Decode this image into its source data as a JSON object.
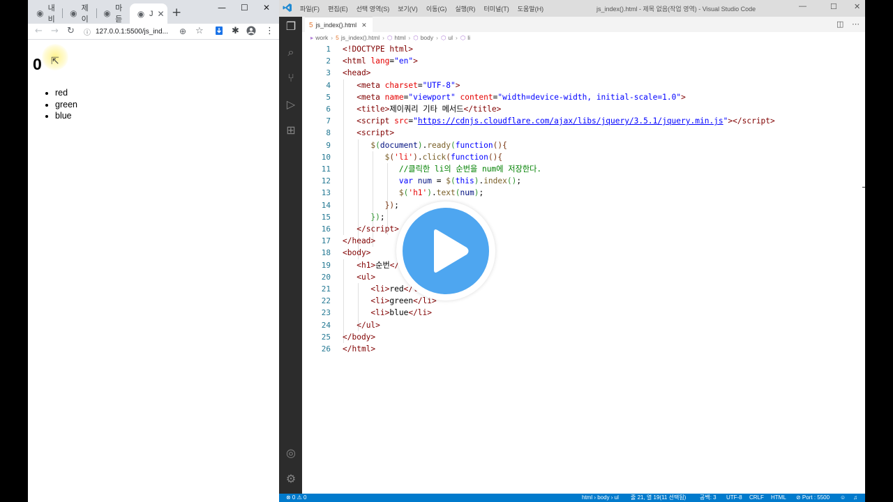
{
  "browser": {
    "tabs": [
      {
        "label": "내비"
      },
      {
        "label": "제이"
      },
      {
        "label": "마듣"
      },
      {
        "label": "J"
      }
    ],
    "url": "127.0.0.1:5500/js_ind..."
  },
  "page": {
    "heading": "0",
    "list": [
      "red",
      "green",
      "blue"
    ]
  },
  "vscode": {
    "menu": [
      "파일(F)",
      "편집(E)",
      "선택 영역(S)",
      "보기(V)",
      "이동(G)",
      "실행(R)",
      "터미널(T)",
      "도움말(H)"
    ],
    "window_title": "js_index().html - 제목 없음(작업 영역) - Visual Studio Code",
    "tab_label": "js_index().html",
    "breadcrumb": [
      "work",
      "js_index().html",
      "html",
      "body",
      "ul",
      "li"
    ],
    "line_numbers": [
      "1",
      "2",
      "3",
      "4",
      "5",
      "6",
      "7",
      "8",
      "9",
      "10",
      "11",
      "12",
      "13",
      "14",
      "15",
      "16",
      "17",
      "18",
      "19",
      "20",
      "21",
      "22",
      "23",
      "24",
      "25",
      "26"
    ],
    "code": {
      "l1": "<!DOCTYPE html>",
      "l6_title": "제이쿼리 기타 메서드",
      "l8_src": "https://cdnjs.cloudflare.com/ajax/libs/jquery/3.5.1/jquery.min.js",
      "l11_comment": "//클릭한 li의 순번을 num에 저장한다.",
      "l19_text": "순번"
    },
    "status": {
      "errors": "⊗ 0 ⚠ 0",
      "breadcrumb": "html › body › ul",
      "position": "줄 21, 열 19(11 선택됨)",
      "spaces": "공백: 3",
      "encoding": "UTF-8",
      "eol": "CRLF",
      "language": "HTML",
      "port": "⊘ Port : 5500"
    }
  }
}
